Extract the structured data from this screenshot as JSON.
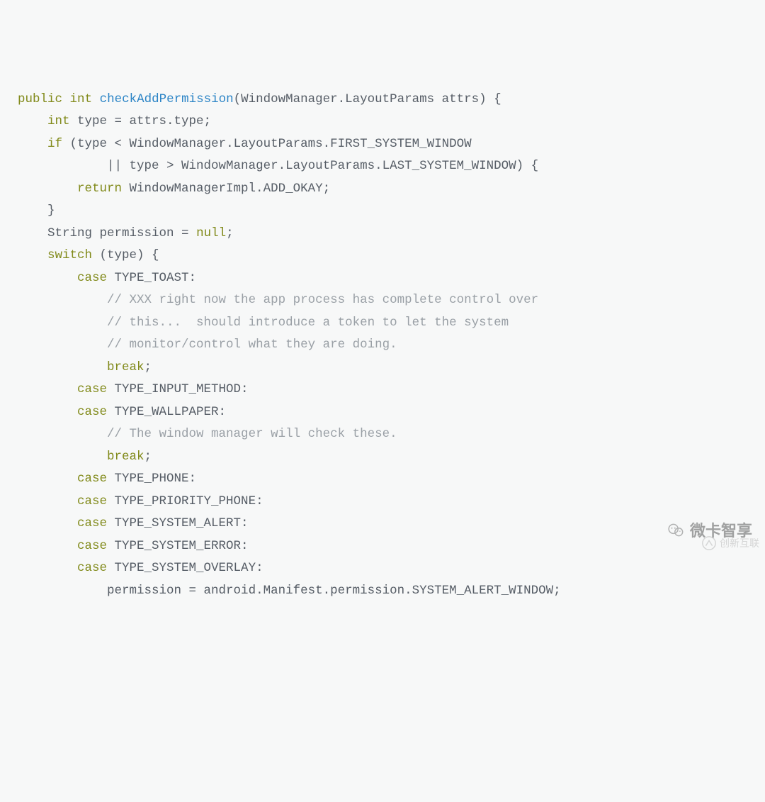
{
  "code": {
    "lines": [
      {
        "indent": 0,
        "tokens": [
          {
            "t": "public",
            "c": "kw"
          },
          {
            "t": " "
          },
          {
            "t": "int",
            "c": "kw"
          },
          {
            "t": " "
          },
          {
            "t": "checkAddPermission",
            "c": "fn"
          },
          {
            "t": "(WindowManager.LayoutParams attrs) {"
          }
        ]
      },
      {
        "indent": 1,
        "tokens": [
          {
            "t": "int",
            "c": "kw"
          },
          {
            "t": " type = attrs.type;"
          }
        ]
      },
      {
        "indent": 0,
        "tokens": [
          {
            "t": ""
          }
        ]
      },
      {
        "indent": 1,
        "tokens": [
          {
            "t": "if",
            "c": "kw"
          },
          {
            "t": " (type < WindowManager.LayoutParams.FIRST_SYSTEM_WINDOW"
          }
        ]
      },
      {
        "indent": 3,
        "tokens": [
          {
            "t": "|| type > WindowManager.LayoutParams.LAST_SYSTEM_WINDOW) {"
          }
        ]
      },
      {
        "indent": 2,
        "tokens": [
          {
            "t": "return",
            "c": "kw"
          },
          {
            "t": " WindowManagerImpl.ADD_OKAY;"
          }
        ]
      },
      {
        "indent": 1,
        "tokens": [
          {
            "t": "}"
          }
        ]
      },
      {
        "indent": 1,
        "tokens": [
          {
            "t": "String permission = "
          },
          {
            "t": "null",
            "c": "kw"
          },
          {
            "t": ";"
          }
        ]
      },
      {
        "indent": 1,
        "tokens": [
          {
            "t": "switch",
            "c": "kw"
          },
          {
            "t": " (type) {"
          }
        ]
      },
      {
        "indent": 2,
        "tokens": [
          {
            "t": "case",
            "c": "kw"
          },
          {
            "t": " TYPE_TOAST:"
          }
        ]
      },
      {
        "indent": 3,
        "tokens": [
          {
            "t": "// XXX right now the app process has complete control over",
            "c": "cmt"
          }
        ]
      },
      {
        "indent": 3,
        "tokens": [
          {
            "t": "// this...  should introduce a token to let the system",
            "c": "cmt"
          }
        ]
      },
      {
        "indent": 3,
        "tokens": [
          {
            "t": "// monitor/control what they are doing.",
            "c": "cmt"
          }
        ]
      },
      {
        "indent": 3,
        "tokens": [
          {
            "t": "break",
            "c": "kw"
          },
          {
            "t": ";"
          }
        ]
      },
      {
        "indent": 2,
        "tokens": [
          {
            "t": "case",
            "c": "kw"
          },
          {
            "t": " TYPE_INPUT_METHOD:"
          }
        ]
      },
      {
        "indent": 2,
        "tokens": [
          {
            "t": "case",
            "c": "kw"
          },
          {
            "t": " TYPE_WALLPAPER:"
          }
        ]
      },
      {
        "indent": 3,
        "tokens": [
          {
            "t": "// The window manager will check these.",
            "c": "cmt"
          }
        ]
      },
      {
        "indent": 3,
        "tokens": [
          {
            "t": "break",
            "c": "kw"
          },
          {
            "t": ";"
          }
        ]
      },
      {
        "indent": 2,
        "tokens": [
          {
            "t": "case",
            "c": "kw"
          },
          {
            "t": " TYPE_PHONE:"
          }
        ]
      },
      {
        "indent": 2,
        "tokens": [
          {
            "t": "case",
            "c": "kw"
          },
          {
            "t": " TYPE_PRIORITY_PHONE:"
          }
        ]
      },
      {
        "indent": 2,
        "tokens": [
          {
            "t": "case",
            "c": "kw"
          },
          {
            "t": " TYPE_SYSTEM_ALERT:"
          }
        ]
      },
      {
        "indent": 2,
        "tokens": [
          {
            "t": "case",
            "c": "kw"
          },
          {
            "t": " TYPE_SYSTEM_ERROR:"
          }
        ]
      },
      {
        "indent": 2,
        "tokens": [
          {
            "t": "case",
            "c": "kw"
          },
          {
            "t": " TYPE_SYSTEM_OVERLAY:"
          }
        ]
      },
      {
        "indent": 3,
        "tokens": [
          {
            "t": "permission = android.Manifest.permission.SYSTEM_ALERT_WINDOW;"
          }
        ]
      }
    ],
    "indent_unit": "    "
  },
  "watermark_right": "微卡智享",
  "watermark_corner": "创新互联"
}
